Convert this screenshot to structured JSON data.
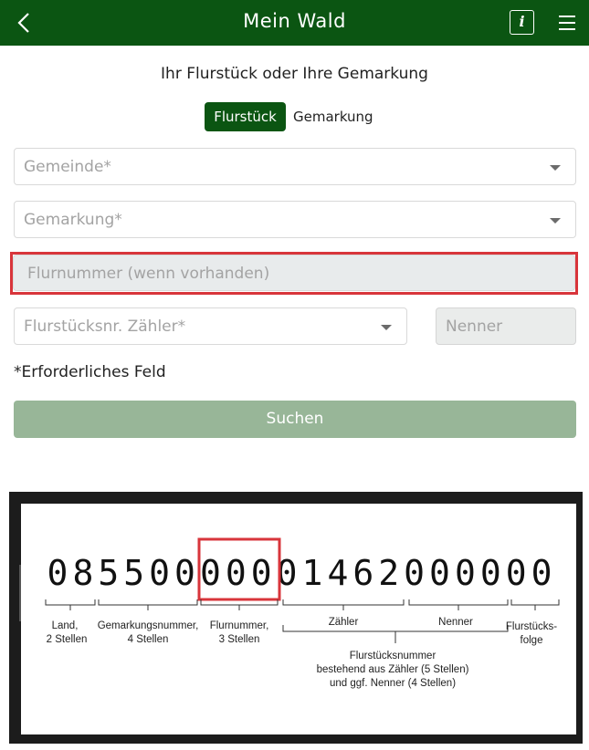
{
  "header": {
    "title": "Mein Wald",
    "back_icon": "chevron-left-icon",
    "info_label": "i",
    "menu_icon": "hamburger-menu-icon",
    "background": "#0b5512"
  },
  "form": {
    "subtitle": "Ihr Flurstück oder Ihre Gemarkung",
    "toggle": {
      "active_label": "Flurstück",
      "inactive_label": "Gemarkung"
    },
    "gemeinde_placeholder": "Gemeinde*",
    "gemarkung_placeholder": "Gemarkung*",
    "flurnummer_placeholder": "Flurnummer (wenn vorhanden)",
    "zaehler_placeholder": "Flurstücksnr. Zähler*",
    "nenner_placeholder": "Nenner",
    "required_note": "*Erforderliches Feld",
    "search_label": "Suchen",
    "highlight_color": "#d8353b"
  },
  "figure": {
    "digits": [
      "0",
      "8",
      "5",
      "5",
      "0",
      "0",
      "0",
      "0",
      "0",
      "0",
      "1",
      "4",
      "6",
      "2",
      "0",
      "0",
      "0",
      "0",
      "0",
      "0"
    ],
    "labels": {
      "land_1": "Land,",
      "land_2": "2 Stellen",
      "gemarkung_1": "Gemarkungsnummer,",
      "gemarkung_2": "4 Stellen",
      "flurnummer_1": "Flurnummer,",
      "flurnummer_2": "3 Stellen",
      "zaehler": "Zähler",
      "nenner": "Nenner",
      "folge_1": "Flurstücks-",
      "folge_2": "folge",
      "flurstueck_1": "Flurstücksnummer",
      "flurstueck_2": "bestehend aus Zähler (5 Stellen)",
      "flurstueck_3": "und ggf. Nenner (4 Stellen)"
    }
  }
}
